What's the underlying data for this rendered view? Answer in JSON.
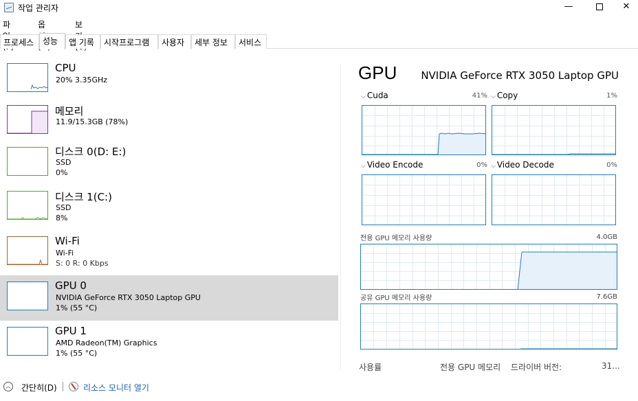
{
  "window": {
    "title": "작업 관리자",
    "min_glyph": "—",
    "close_glyph": "✕"
  },
  "menu": [
    "파일(F)",
    "옵션(O)",
    "보기(V)"
  ],
  "tabs": [
    "프로세스",
    "성능",
    "앱 기록",
    "시작프로그램",
    "사용자",
    "세부 정보",
    "서비스"
  ],
  "active_tab": "성능",
  "resources": [
    {
      "name": "CPU",
      "line1": "20% 3.35GHz",
      "line2": "",
      "color": "#1a7fc1",
      "usage": 0.2
    },
    {
      "name": "메모리",
      "line1": "11.9/15.3GB (78%)",
      "line2": "",
      "color": "#8b2bb0",
      "usage": 0.78
    },
    {
      "name": "디스크 0(D: E:)",
      "line1": "SSD",
      "line2": "0%",
      "color": "#4da831",
      "usage": 0.0
    },
    {
      "name": "디스크 1(C:)",
      "line1": "SSD",
      "line2": "8%",
      "color": "#4da831",
      "usage": 0.08
    },
    {
      "name": "Wi-Fi",
      "line1": "Wi-Fi",
      "line2": "S: 0 R: 0 Kbps",
      "color": "#a8622b",
      "usage": 0.0
    },
    {
      "name": "GPU 0",
      "line1": "NVIDIA GeForce RTX 3050 Laptop GPU",
      "line2": "1% (55 °C)",
      "color": "#1a7fc1",
      "usage": 0.01
    },
    {
      "name": "GPU 1",
      "line1": "AMD Radeon(TM) Graphics",
      "line2": "1% (55 °C)",
      "color": "#1a7fc1",
      "usage": 0.01
    }
  ],
  "selected_resource": "GPU 0",
  "gpu": {
    "title": "GPU",
    "model": "NVIDIA GeForce RTX 3050 Laptop GPU",
    "engines": [
      {
        "label": "Cuda",
        "pct": "41%"
      },
      {
        "label": "Copy",
        "pct": "1%"
      },
      {
        "label": "Video Encode",
        "pct": "0%"
      },
      {
        "label": "Video Decode",
        "pct": "0%"
      }
    ],
    "dedicated_mem_label": "전용 GPU 메모리 사용량",
    "dedicated_mem_max": "4.0GB",
    "shared_mem_label": "공유 GPU 메모리 사용량",
    "shared_mem_max": "7.6GB",
    "footer": {
      "usage_label": "사용률",
      "dedicated_label": "전용 GPU 메모리",
      "driver_label": "드라이버 버전:",
      "driver_value": "31..."
    }
  },
  "status": {
    "collapse_label": "간단히(D)",
    "resmon_label": "리소스 모니터 열기"
  },
  "colors": {
    "accent": "#1a7fc1",
    "selected_bg": "#d9d9d9"
  }
}
